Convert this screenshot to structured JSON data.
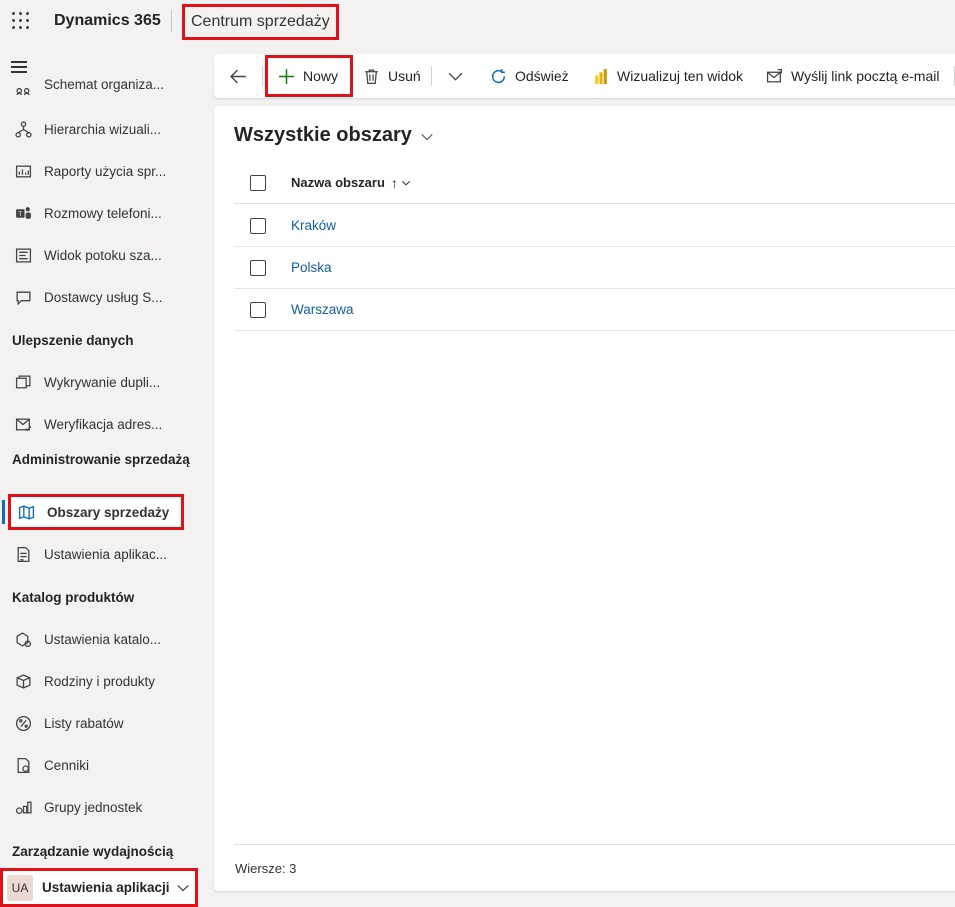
{
  "header": {
    "brand": "Dynamics 365",
    "app_name": "Centrum sprzedaży"
  },
  "sidebar": {
    "items": [
      {
        "label": "Schemat organiza...",
        "icon": "org-chart-icon"
      },
      {
        "label": "Hierarchia wizuali...",
        "icon": "hierarchy-icon"
      },
      {
        "label": "Raporty użycia spr...",
        "icon": "report-icon"
      },
      {
        "label": "Rozmowy telefoni...",
        "icon": "teams-icon"
      },
      {
        "label": "Widok potoku sza...",
        "icon": "pipeline-icon"
      },
      {
        "label": "Dostawcy usług S...",
        "icon": "chat-icon"
      }
    ],
    "section_data": "Ulepszenie danych",
    "data_items": [
      {
        "label": "Wykrywanie dupli...",
        "icon": "duplicate-icon"
      },
      {
        "label": "Weryfikacja adres...",
        "icon": "mail-check-icon"
      }
    ],
    "section_admin": "Administrowanie sprzedażą",
    "admin_items": [
      {
        "label": "Obszary sprzedaży",
        "icon": "map-icon",
        "selected": true
      },
      {
        "label": "Ustawienia aplikac...",
        "icon": "settings-doc-icon"
      }
    ],
    "section_catalog": "Katalog produktów",
    "catalog_items": [
      {
        "label": "Ustawienia katalo...",
        "icon": "catalog-settings-icon"
      },
      {
        "label": "Rodziny i produkty",
        "icon": "box-icon"
      },
      {
        "label": "Listy rabatów",
        "icon": "percent-icon"
      },
      {
        "label": "Cenniki",
        "icon": "price-list-icon"
      },
      {
        "label": "Grupy jednostek",
        "icon": "units-icon"
      }
    ],
    "section_perf": "Zarządzanie wydajnością",
    "area_switcher": {
      "avatar": "UA",
      "label": "Ustawienia aplikacji"
    }
  },
  "commands": {
    "new": "Nowy",
    "delete": "Usuń",
    "refresh": "Odśwież",
    "visualize": "Wizualizuj ten widok",
    "email_link": "Wyślij link pocztą e-mail"
  },
  "view": {
    "title": "Wszystkie obszary",
    "column": "Nazwa obszaru",
    "sort_arrow": "↑",
    "rows": [
      "Kraków",
      "Polska",
      "Warszawa"
    ],
    "footer": "Wiersze: 3"
  },
  "colors": {
    "accent": "#0f6cbd",
    "link": "#115ea3",
    "highlight": "#e0111b"
  }
}
